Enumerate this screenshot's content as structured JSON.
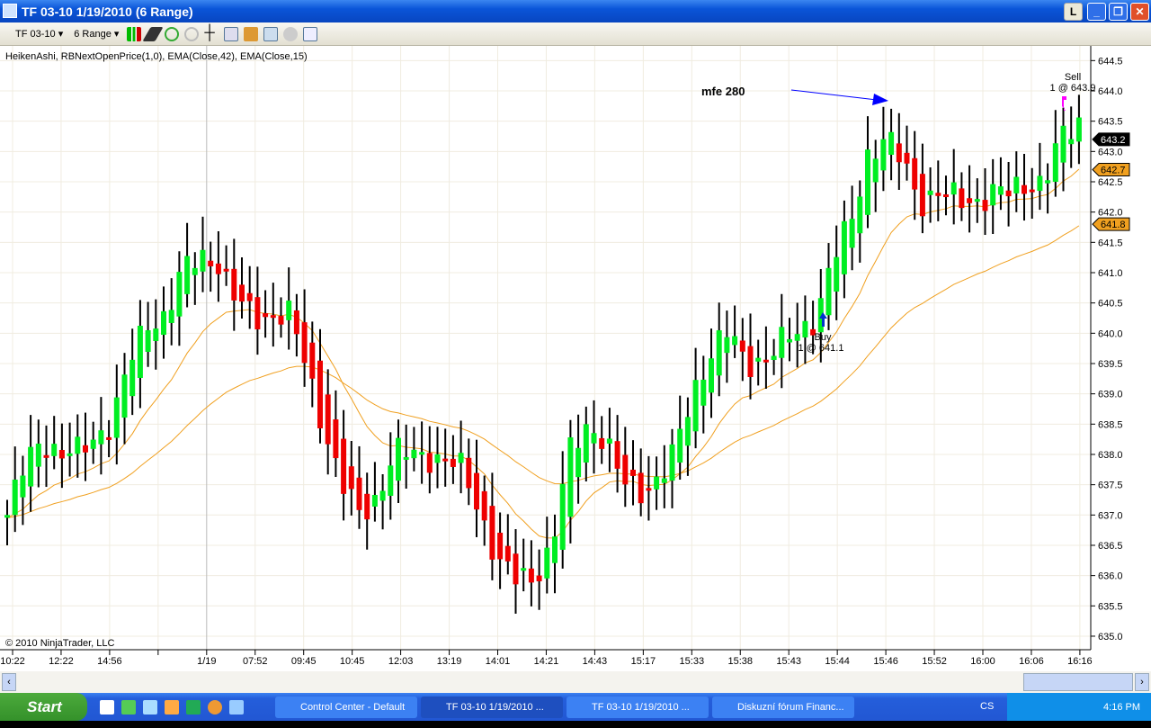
{
  "window": {
    "title": "TF 03-10  1/19/2010 (6 Range)",
    "btn_l": "L"
  },
  "toolbar": {
    "instrument": "TF 03-10",
    "period": "6 Range"
  },
  "chart": {
    "indicators_label": "HeikenAshi, RBNextOpenPrice(1,0), EMA(Close,42), EMA(Close,15)",
    "copyright": "© 2010 NinjaTrader, LLC",
    "annotation": "mfe 280",
    "buy_label": "Buy",
    "buy_detail": "1 @ 641.1",
    "sell_label": "Sell",
    "sell_detail": "1 @ 643.9",
    "last_price": "643.2",
    "ema15_marker": "642.7",
    "ema42_marker": "641.8",
    "colors": {
      "up": "#00ee22",
      "down": "#ee0000",
      "ema": "#f0a020",
      "buy": "#0033cc",
      "sell": "#ff00ff"
    }
  },
  "chart_data": {
    "type": "candlestick",
    "ylim": [
      634.9,
      644.7
    ],
    "y_ticks": [
      "644.5",
      "644.0",
      "643.5",
      "643.0",
      "642.5",
      "642.0",
      "641.5",
      "641.0",
      "640.5",
      "640.0",
      "639.5",
      "639.0",
      "638.5",
      "638.0",
      "637.5",
      "637.0",
      "636.5",
      "636.0",
      "635.5",
      "635.0"
    ],
    "x_ticks": [
      "10:22",
      "12:22",
      "14:56",
      "",
      "1/19",
      "07:52",
      "09:45",
      "10:45",
      "12:03",
      "13:19",
      "14:01",
      "14:21",
      "14:43",
      "15:17",
      "15:33",
      "15:38",
      "15:43",
      "15:44",
      "15:46",
      "15:52",
      "16:00",
      "16:06",
      "16:16"
    ],
    "close_path": [
      637.0,
      637.8,
      638.3,
      638.0,
      638.0,
      638.3,
      638.6,
      639.5,
      640.2,
      640.3,
      641.0,
      641.3,
      641.2,
      640.5,
      640.3,
      640.3,
      640.3,
      639.5,
      638.5,
      637.5,
      637.0,
      637.3,
      638.0,
      638.0,
      638.0,
      637.9,
      637.7,
      637.0,
      636.2,
      635.9,
      636.0,
      636.5,
      638.0,
      638.5,
      638.3,
      637.5,
      637.4,
      637.6,
      638.0,
      639.0,
      639.7,
      640.0,
      639.5,
      639.6,
      639.8,
      640.0,
      640.3,
      641.2,
      641.8,
      643.0,
      643.2,
      642.8,
      642.2,
      642.3,
      642.2,
      642.2,
      642.3,
      642.3,
      642.5,
      642.5,
      643.2,
      643.5
    ]
  },
  "taskbar": {
    "start": "Start",
    "tasks": [
      "Control Center - Default",
      "TF 03-10  1/19/2010 ...",
      "TF 03-10  1/19/2010 ...",
      "Diskuzní fórum Financ..."
    ],
    "lang": "CS",
    "clock": "4:16 PM"
  }
}
